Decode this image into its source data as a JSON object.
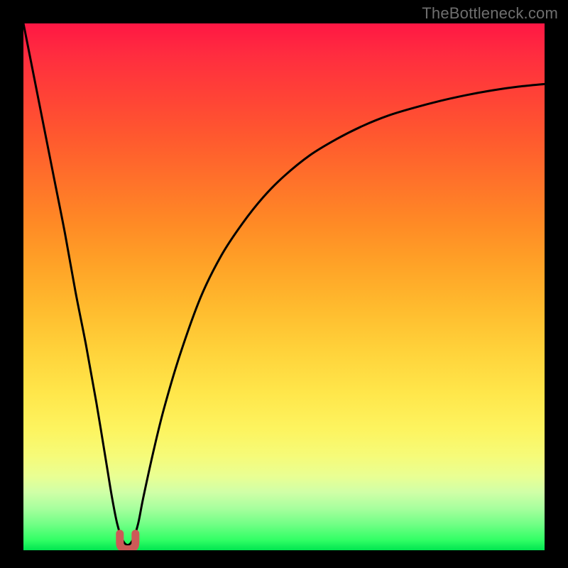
{
  "watermark": "TheBottleneck.com",
  "colors": {
    "page_background": "#000000",
    "curve": "#000000",
    "marker_fill": "#cc5a57",
    "marker_stroke": "#b94a47"
  },
  "chart_data": {
    "type": "line",
    "title": "",
    "xlabel": "",
    "ylabel": "",
    "xlim": [
      0,
      100
    ],
    "ylim": [
      0,
      100
    ],
    "grid": false,
    "series": [
      {
        "name": "bottleneck_curve",
        "x": [
          0,
          2,
          4,
          6,
          8,
          10,
          12,
          14,
          16,
          17,
          18,
          19,
          20,
          21,
          22,
          23,
          25,
          27,
          30,
          34,
          38,
          42,
          46,
          50,
          55,
          60,
          65,
          70,
          75,
          80,
          85,
          90,
          95,
          100
        ],
        "y": [
          100,
          90,
          80,
          70,
          60,
          49,
          39,
          28,
          16,
          10,
          5,
          2,
          1,
          2,
          5,
          10,
          19,
          27,
          37,
          48,
          56,
          62,
          67,
          71,
          75,
          78,
          80.5,
          82.5,
          84,
          85.3,
          86.4,
          87.3,
          88,
          88.5
        ]
      }
    ],
    "annotations": [
      {
        "type": "background_gradient",
        "top_color": "#ff1744",
        "bottom_color": "#00e550"
      },
      {
        "type": "min_marker",
        "x": 20,
        "y": 1,
        "shape": "u",
        "color": "#cc5a57"
      }
    ]
  }
}
